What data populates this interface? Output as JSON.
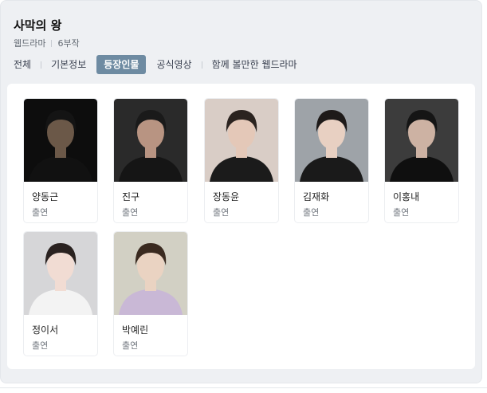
{
  "header": {
    "title": "사막의 왕",
    "meta_type": "웹드라마",
    "meta_episodes": "6부작"
  },
  "tabs": [
    {
      "label": "전체"
    },
    {
      "label": "기본정보"
    },
    {
      "label": "등장인물",
      "active": true
    },
    {
      "label": "공식영상"
    },
    {
      "label": "함께 볼만한 웹드라마"
    }
  ],
  "cast": [
    {
      "name": "양동근",
      "role": "출연",
      "bg": "#0d0d0d",
      "skin": "#6b5848",
      "hair": "#141414",
      "top": "#111111"
    },
    {
      "name": "진구",
      "role": "출연",
      "bg": "#2a2a2a",
      "skin": "#b89482",
      "hair": "#1a1a1a",
      "top": "#151515"
    },
    {
      "name": "장동윤",
      "role": "출연",
      "bg": "#d9cdc6",
      "skin": "#e4c8b8",
      "hair": "#2b231f",
      "top": "#1b1b1b"
    },
    {
      "name": "김재화",
      "role": "출연",
      "bg": "#9ea3a8",
      "skin": "#e8d0c2",
      "hair": "#1e1a19",
      "top": "#1a1a1a"
    },
    {
      "name": "이홍내",
      "role": "출연",
      "bg": "#3c3c3c",
      "skin": "#cdb2a3",
      "hair": "#151515",
      "top": "#0f0f0f"
    },
    {
      "name": "정이서",
      "role": "출연",
      "bg": "#d6d6d8",
      "skin": "#f1dcd3",
      "hair": "#2a2220",
      "top": "#f3f3f3"
    },
    {
      "name": "박예린",
      "role": "출연",
      "bg": "#d2d0c4",
      "skin": "#ead3c2",
      "hair": "#3a2a20",
      "top": "#c9b8d6"
    }
  ]
}
